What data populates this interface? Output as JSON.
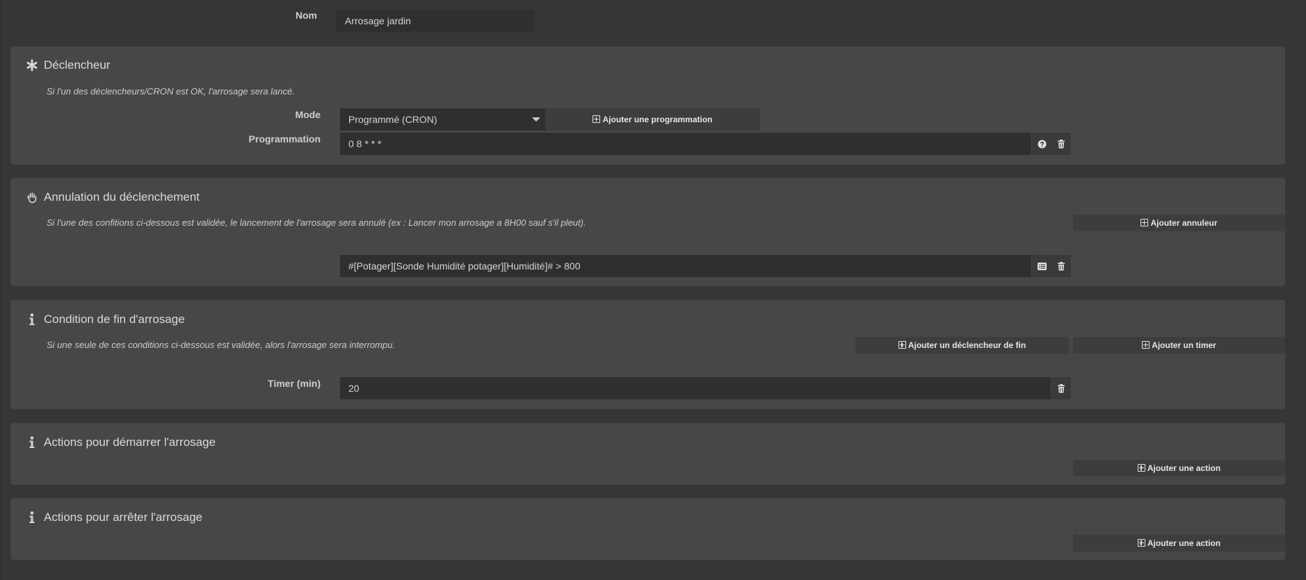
{
  "nom": {
    "label": "Nom",
    "value": "Arrosage jardin"
  },
  "declencheur": {
    "title": "Déclencheur",
    "icon": "asterisk-icon",
    "description": "Si l'un des déclencheurs/CRON est OK, l'arrosage sera lancé.",
    "mode_label": "Mode",
    "mode_value": "Programmé (CRON)",
    "add_button": "Ajouter une programmation",
    "programmation_label": "Programmation",
    "programmation_value": "0 8 * * *"
  },
  "annulation": {
    "title": "Annulation du déclenchement",
    "icon": "hand-icon",
    "description": "Si l'une des confitions ci-dessous est validée, le lancement de l'arrosage sera annulé (ex : Lancer mon arrosage a 8H00 sauf s'il pleut).",
    "add_button": "Ajouter annuleur",
    "condition_value": "#[Potager][Sonde Humidité potager][Humidité]# > 800"
  },
  "fin": {
    "title": "Condition de fin d'arrosage",
    "icon": "info-icon",
    "description": "Si une seule de ces conditions ci-dessous est validée, alors l'arrosage sera interrompu.",
    "add_end_trigger_button": "Ajouter un déclencheur de fin",
    "add_timer_button": "Ajouter un timer",
    "timer_label": "Timer (min)",
    "timer_value": "20"
  },
  "demarrer": {
    "title": "Actions pour démarrer l'arrosage",
    "icon": "info-icon",
    "add_button": "Ajouter une action"
  },
  "arreter": {
    "title": "Actions pour arrêter l'arrosage",
    "icon": "info-icon",
    "add_button": "Ajouter une action"
  },
  "colors": {
    "background": "#363636",
    "panel": "#474747",
    "input": "#2f2f2f",
    "button": "#3d3d3d",
    "text": "#d8d8d8"
  }
}
